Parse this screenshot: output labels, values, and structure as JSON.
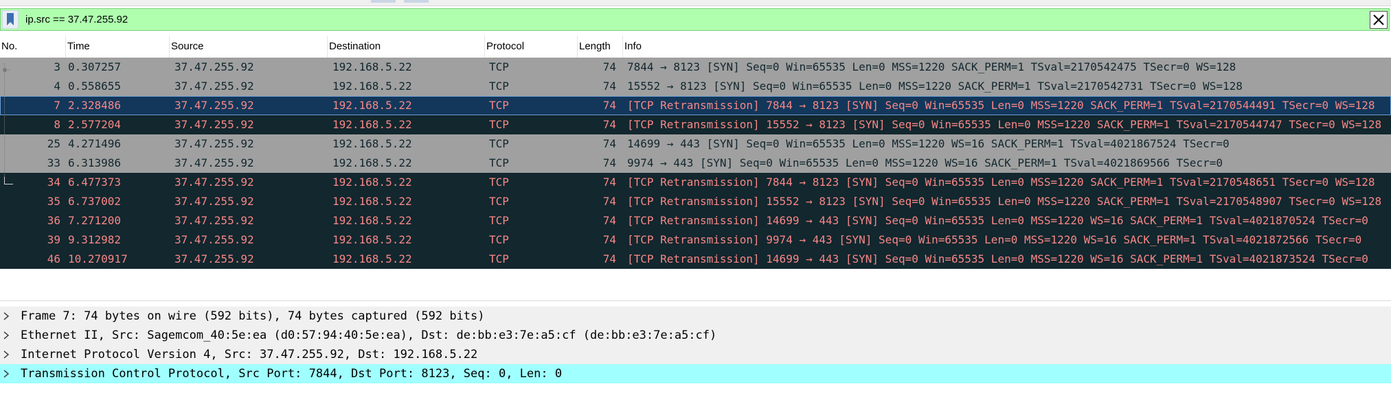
{
  "filter": {
    "value": "ip.src == 37.47.255.92"
  },
  "columns": [
    "No.",
    "Time",
    "Source",
    "Destination",
    "Protocol",
    "Length",
    "Info"
  ],
  "packets": [
    {
      "no": "3",
      "time": "0.307257",
      "src": "37.47.255.92",
      "dst": "192.168.5.22",
      "proto": "TCP",
      "len": "74",
      "info": "7844 → 8123 [SYN] Seq=0 Win=65535 Len=0 MSS=1220 SACK_PERM=1 TSval=2170542475 TSecr=0 WS=128",
      "style": "grey"
    },
    {
      "no": "4",
      "time": "0.558655",
      "src": "37.47.255.92",
      "dst": "192.168.5.22",
      "proto": "TCP",
      "len": "74",
      "info": "15552 → 8123 [SYN] Seq=0 Win=65535 Len=0 MSS=1220 SACK_PERM=1 TSval=2170542731 TSecr=0 WS=128",
      "style": "grey"
    },
    {
      "no": "7",
      "time": "2.328486",
      "src": "37.47.255.92",
      "dst": "192.168.5.22",
      "proto": "TCP",
      "len": "74",
      "info": "[TCP Retransmission] 7844 → 8123 [SYN] Seq=0 Win=65535 Len=0 MSS=1220 SACK_PERM=1 TSval=2170544491 TSecr=0 WS=128",
      "style": "selected"
    },
    {
      "no": "8",
      "time": "2.577204",
      "src": "37.47.255.92",
      "dst": "192.168.5.22",
      "proto": "TCP",
      "len": "74",
      "info": "[TCP Retransmission] 15552 → 8123 [SYN] Seq=0 Win=65535 Len=0 MSS=1220 SACK_PERM=1 TSval=2170544747 TSecr=0 WS=128",
      "style": "dark"
    },
    {
      "no": "25",
      "time": "4.271496",
      "src": "37.47.255.92",
      "dst": "192.168.5.22",
      "proto": "TCP",
      "len": "74",
      "info": "14699 → 443 [SYN] Seq=0 Win=65535 Len=0 MSS=1220 WS=16 SACK_PERM=1 TSval=4021867524 TSecr=0",
      "style": "grey"
    },
    {
      "no": "33",
      "time": "6.313986",
      "src": "37.47.255.92",
      "dst": "192.168.5.22",
      "proto": "TCP",
      "len": "74",
      "info": "9974 → 443 [SYN] Seq=0 Win=65535 Len=0 MSS=1220 WS=16 SACK_PERM=1 TSval=4021869566 TSecr=0",
      "style": "grey"
    },
    {
      "no": "34",
      "time": "6.477373",
      "src": "37.47.255.92",
      "dst": "192.168.5.22",
      "proto": "TCP",
      "len": "74",
      "info": "[TCP Retransmission] 7844 → 8123 [SYN] Seq=0 Win=65535 Len=0 MSS=1220 SACK_PERM=1 TSval=2170548651 TSecr=0 WS=128",
      "style": "dark"
    },
    {
      "no": "35",
      "time": "6.737002",
      "src": "37.47.255.92",
      "dst": "192.168.5.22",
      "proto": "TCP",
      "len": "74",
      "info": "[TCP Retransmission] 15552 → 8123 [SYN] Seq=0 Win=65535 Len=0 MSS=1220 SACK_PERM=1 TSval=2170548907 TSecr=0 WS=128",
      "style": "dark"
    },
    {
      "no": "36",
      "time": "7.271200",
      "src": "37.47.255.92",
      "dst": "192.168.5.22",
      "proto": "TCP",
      "len": "74",
      "info": "[TCP Retransmission] 14699 → 443 [SYN] Seq=0 Win=65535 Len=0 MSS=1220 WS=16 SACK_PERM=1 TSval=4021870524 TSecr=0",
      "style": "dark"
    },
    {
      "no": "39",
      "time": "9.312982",
      "src": "37.47.255.92",
      "dst": "192.168.5.22",
      "proto": "TCP",
      "len": "74",
      "info": "[TCP Retransmission] 9974 → 443 [SYN] Seq=0 Win=65535 Len=0 MSS=1220 WS=16 SACK_PERM=1 TSval=4021872566 TSecr=0",
      "style": "dark"
    },
    {
      "no": "46",
      "time": "10.270917",
      "src": "37.47.255.92",
      "dst": "192.168.5.22",
      "proto": "TCP",
      "len": "74",
      "info": "[TCP Retransmission] 14699 → 443 [SYN] Seq=0 Win=65535 Len=0 MSS=1220 WS=16 SACK_PERM=1 TSval=4021873524 TSecr=0",
      "style": "dark"
    }
  ],
  "details": [
    {
      "text": "Frame 7: 74 bytes on wire (592 bits), 74 bytes captured (592 bits)",
      "highlight": false
    },
    {
      "text": "Ethernet II, Src: Sagemcom_40:5e:ea (d0:57:94:40:5e:ea), Dst: de:bb:e3:7e:a5:cf (de:bb:e3:7e:a5:cf)",
      "highlight": false
    },
    {
      "text": "Internet Protocol Version 4, Src: 37.47.255.92, Dst: 192.168.5.22",
      "highlight": false
    },
    {
      "text": "Transmission Control Protocol, Src Port: 7844, Dst Port: 8123, Seq: 0, Len: 0",
      "highlight": true
    }
  ],
  "colors": {
    "filter_bg": "#afffaf",
    "row_grey_bg": "#a0a0a0",
    "row_dark_bg": "#12272e",
    "row_selected_bg": "#12375a",
    "retrans_text": "#f78787",
    "detail_highlight": "#a0ffff"
  },
  "icons": {
    "bookmark": "bookmark-icon",
    "clear": "close-icon",
    "expand": "chevron-right-icon"
  }
}
